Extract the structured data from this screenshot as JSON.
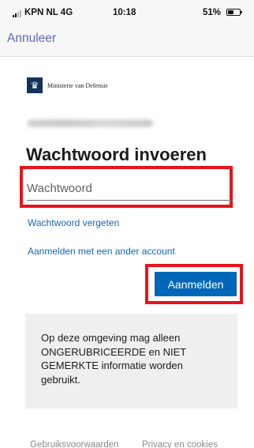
{
  "status_bar": {
    "carrier": "KPN NL 4G",
    "time": "10:18",
    "battery_percent": "51%",
    "battery_level": 0.51
  },
  "nav": {
    "cancel_label": "Annuleer"
  },
  "ministry": {
    "name": "Ministerie van Defensie"
  },
  "form": {
    "heading": "Wachtwoord invoeren",
    "password_placeholder": "Wachtwoord",
    "forgot_password": "Wachtwoord vergeten",
    "other_account": "Aanmelden met een ander account",
    "signin_label": "Aanmelden"
  },
  "notice": {
    "text": "Op deze omgeving mag alleen ONGERUBRICEERDE en NIET GEMERKTE informatie worden gebruikt."
  },
  "footer": {
    "terms": "Gebruiksvoorwaarden",
    "privacy": "Privacy en cookies"
  },
  "colors": {
    "accent": "#0067b8",
    "link": "#1466b8",
    "highlight": "#e8131b"
  }
}
